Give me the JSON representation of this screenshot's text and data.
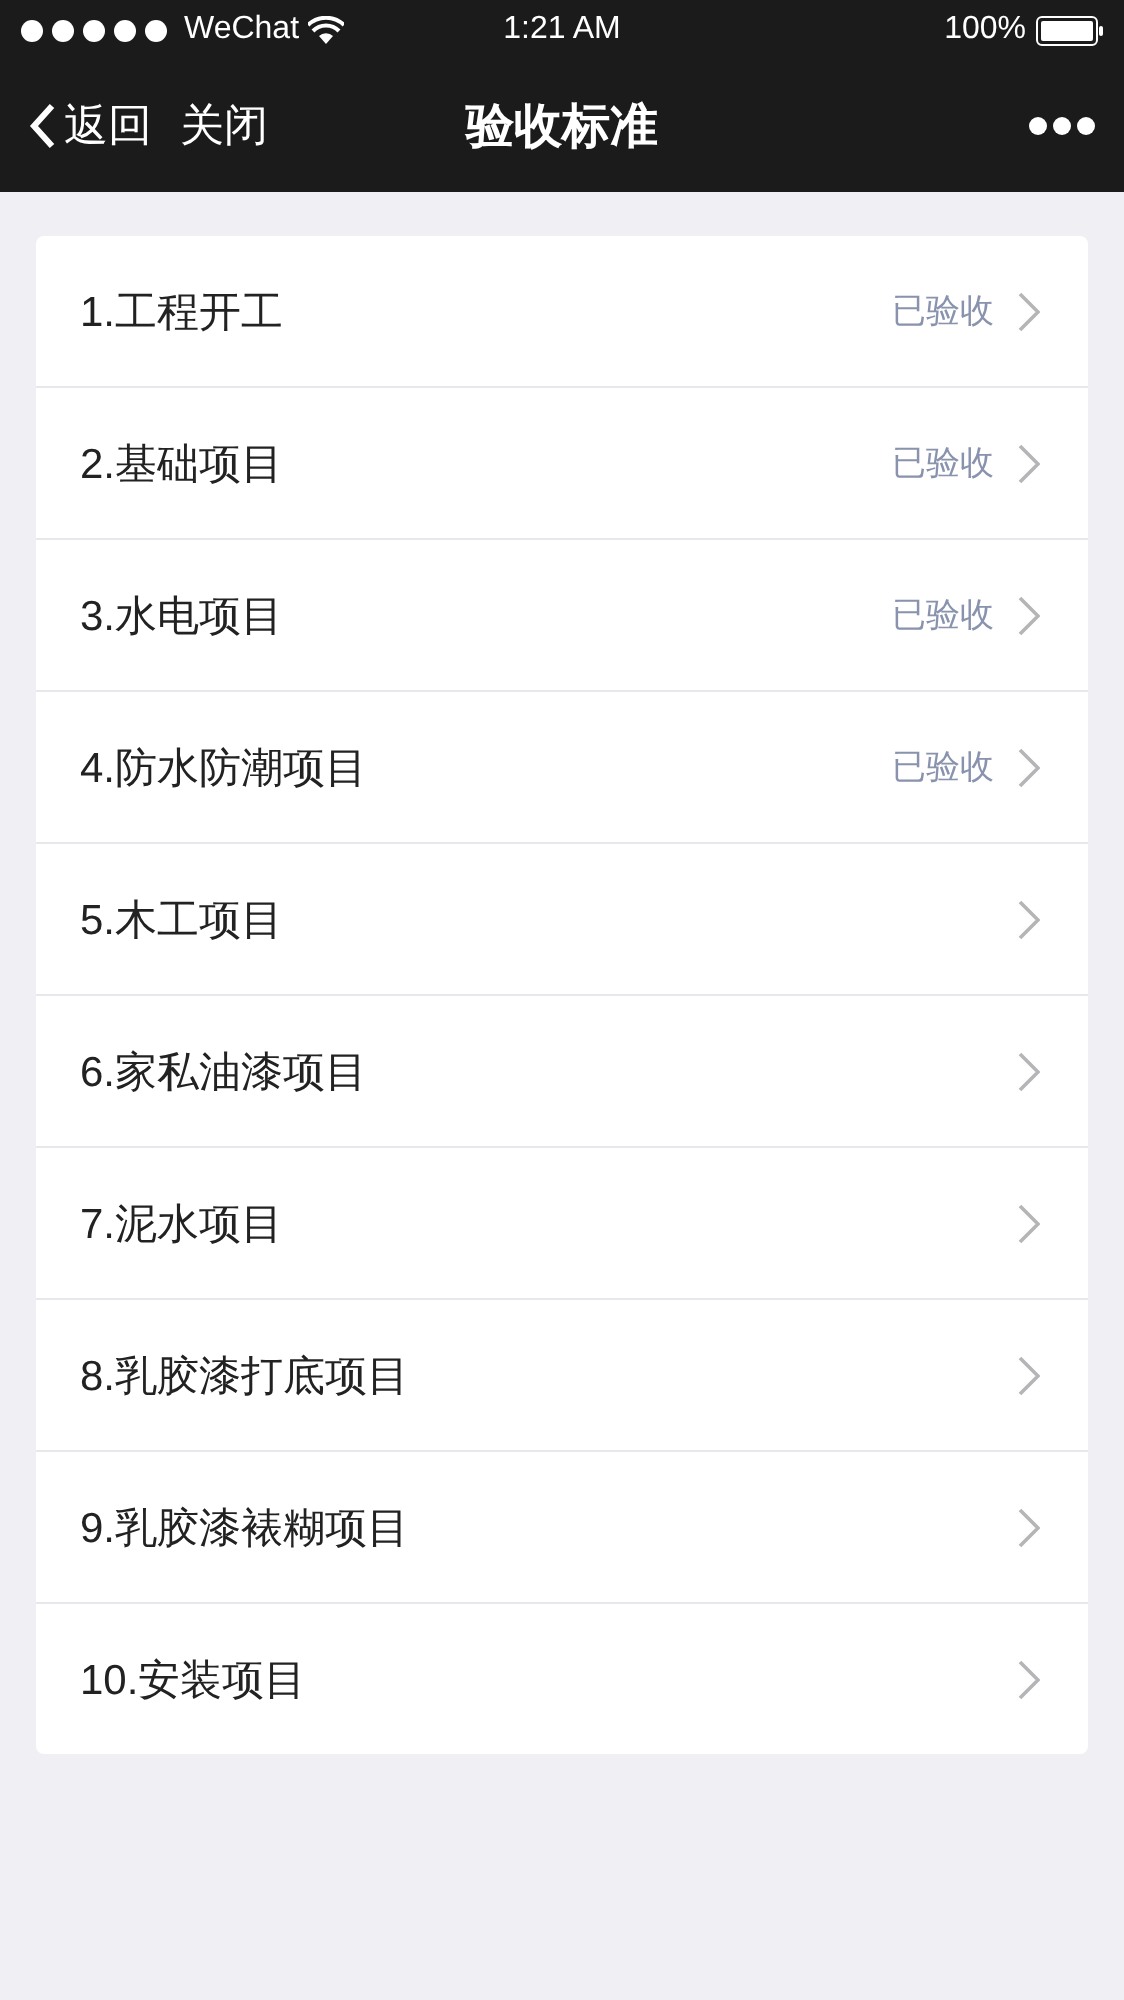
{
  "status_bar": {
    "carrier": "WeChat",
    "time": "1:21 AM",
    "battery": "100%"
  },
  "nav": {
    "back": "返回",
    "close": "关闭",
    "title": "验收标准"
  },
  "items": [
    {
      "label": "1.工程开工",
      "status": "已验收"
    },
    {
      "label": "2.基础项目",
      "status": "已验收"
    },
    {
      "label": "3.水电项目",
      "status": "已验收"
    },
    {
      "label": "4.防水防潮项目",
      "status": "已验收"
    },
    {
      "label": "5.木工项目"
    },
    {
      "label": "6.家私油漆项目"
    },
    {
      "label": "7.泥水项目"
    },
    {
      "label": "8.乳胶漆打底项目"
    },
    {
      "label": "9.乳胶漆裱糊项目"
    },
    {
      "label": "10.安装项目"
    }
  ]
}
